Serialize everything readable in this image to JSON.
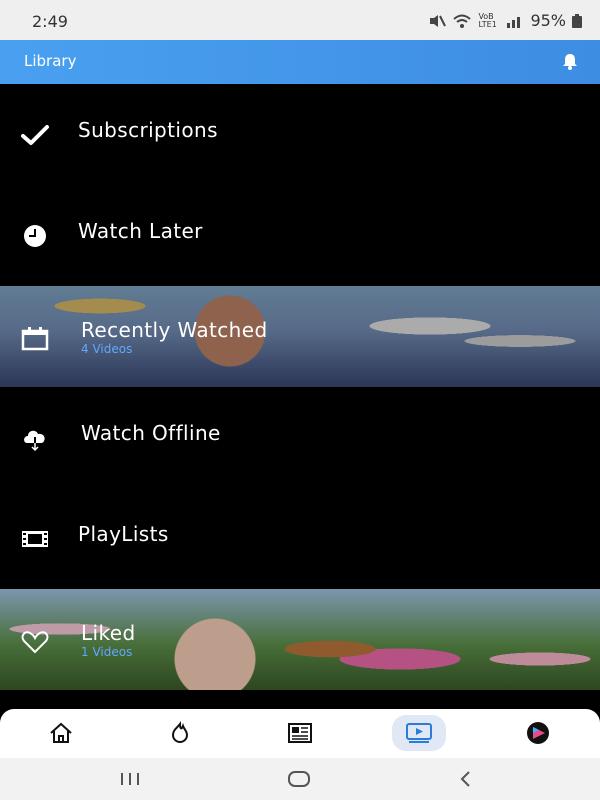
{
  "status": {
    "time": "2:49",
    "network": "VoB LTE1",
    "battery": "95%"
  },
  "appbar": {
    "title": "Library",
    "bell_icon": "bell-icon"
  },
  "menu": {
    "items": [
      {
        "label": "Subscriptions",
        "icon": "check-icon"
      },
      {
        "label": "Watch Later",
        "icon": "clock-icon"
      },
      {
        "label": "Recently Watched",
        "sub": "4 Videos",
        "icon": "calendar-icon"
      },
      {
        "label": "Watch Offline",
        "icon": "cloud-download-icon"
      },
      {
        "label": "PlayLists",
        "icon": "film-strip-icon"
      },
      {
        "label": "Liked",
        "sub": "1 Videos",
        "icon": "heart-icon"
      }
    ]
  },
  "bottom_nav": {
    "items": [
      {
        "name": "home",
        "icon": "home-icon"
      },
      {
        "name": "trending",
        "icon": "trending-icon"
      },
      {
        "name": "subscriptions",
        "icon": "news-icon"
      },
      {
        "name": "library",
        "icon": "library-icon",
        "active": true
      },
      {
        "name": "profile",
        "icon": "avatar-icon"
      }
    ]
  },
  "colors": {
    "accent": "#3d8de3",
    "subtext": "#5fa8ff"
  }
}
